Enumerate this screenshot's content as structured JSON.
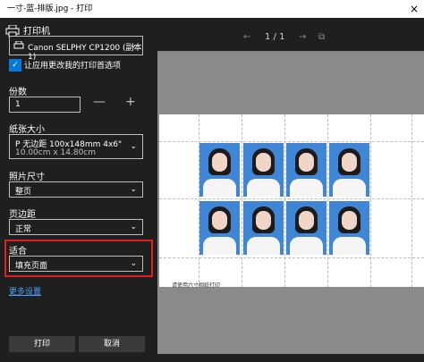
{
  "window": {
    "title": "一寸-蓝-排版.jpg - 打印",
    "close_icon": "×"
  },
  "printer": {
    "label": "打印机",
    "selected": "Canon SELPHY CP1200 (副本 1)"
  },
  "preferences": {
    "label": "让应用更改我的打印首选项",
    "checked": true
  },
  "copies": {
    "label": "份数",
    "value": "1",
    "minus": "—",
    "plus": "+"
  },
  "paper_size": {
    "label": "纸张大小",
    "line1": "P 无边距 100x148mm 4x6\"",
    "line2": "10.00cm x 14.80cm"
  },
  "photo_size": {
    "label": "照片尺寸",
    "selected": "整页"
  },
  "margins": {
    "label": "页边距",
    "selected": "正常"
  },
  "fit": {
    "label": "适合",
    "selected": "填充页面"
  },
  "more_settings": "更多设置",
  "buttons": {
    "print": "打印",
    "cancel": "取消"
  },
  "preview": {
    "page": "1 / 1",
    "caption": "请使用六寸相纸打印"
  },
  "colors": {
    "accent": "#0a78d7",
    "highlight": "#e02020",
    "photo_bg": "#3f87d6"
  }
}
